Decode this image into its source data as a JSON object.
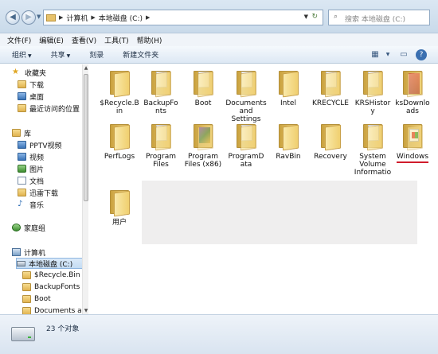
{
  "address": {
    "breadcrumb": [
      "计算机",
      "本地磁盘 (C:)"
    ],
    "search_placeholder": "搜索 本地磁盘 (C:)"
  },
  "menu": [
    "文件(F)",
    "编辑(E)",
    "查看(V)",
    "工具(T)",
    "帮助(H)"
  ],
  "toolbar": {
    "organize": "组织",
    "share": "共享",
    "burn": "刻录",
    "new_folder": "新建文件夹"
  },
  "nav": {
    "favorites": "收藏夹",
    "fav_items": [
      "下载",
      "桌面",
      "最近访问的位置"
    ],
    "libraries": "库",
    "lib_items": [
      "PPTV视频",
      "视频",
      "图片",
      "文档",
      "迅雷下载",
      "音乐"
    ],
    "homegroup": "家庭组",
    "computer": "计算机",
    "drive": "本地磁盘 (C:)",
    "drive_items": [
      "$Recycle.Bin",
      "BackupFonts",
      "Boot",
      "Documents an"
    ]
  },
  "items": [
    [
      "$Recycle.B",
      "in"
    ],
    [
      "BackupFo",
      "nts"
    ],
    [
      "Boot"
    ],
    [
      "Documents",
      "and",
      "Settings"
    ],
    [
      "Intel"
    ],
    [
      "KRECYCLE"
    ],
    [
      "KRSHistor",
      "y"
    ],
    [
      "ksDownlo",
      "ads"
    ],
    [
      "PerfLogs"
    ],
    [
      "Program",
      "Files"
    ],
    [
      "Program",
      "Files (x86)"
    ],
    [
      "ProgramD",
      "ata"
    ],
    [
      "RavBin"
    ],
    [
      "Recovery"
    ],
    [
      "System",
      "Volume",
      "Informatio"
    ],
    [
      "Windows"
    ],
    [
      "用户"
    ]
  ],
  "status": {
    "count": "23 个对象"
  }
}
